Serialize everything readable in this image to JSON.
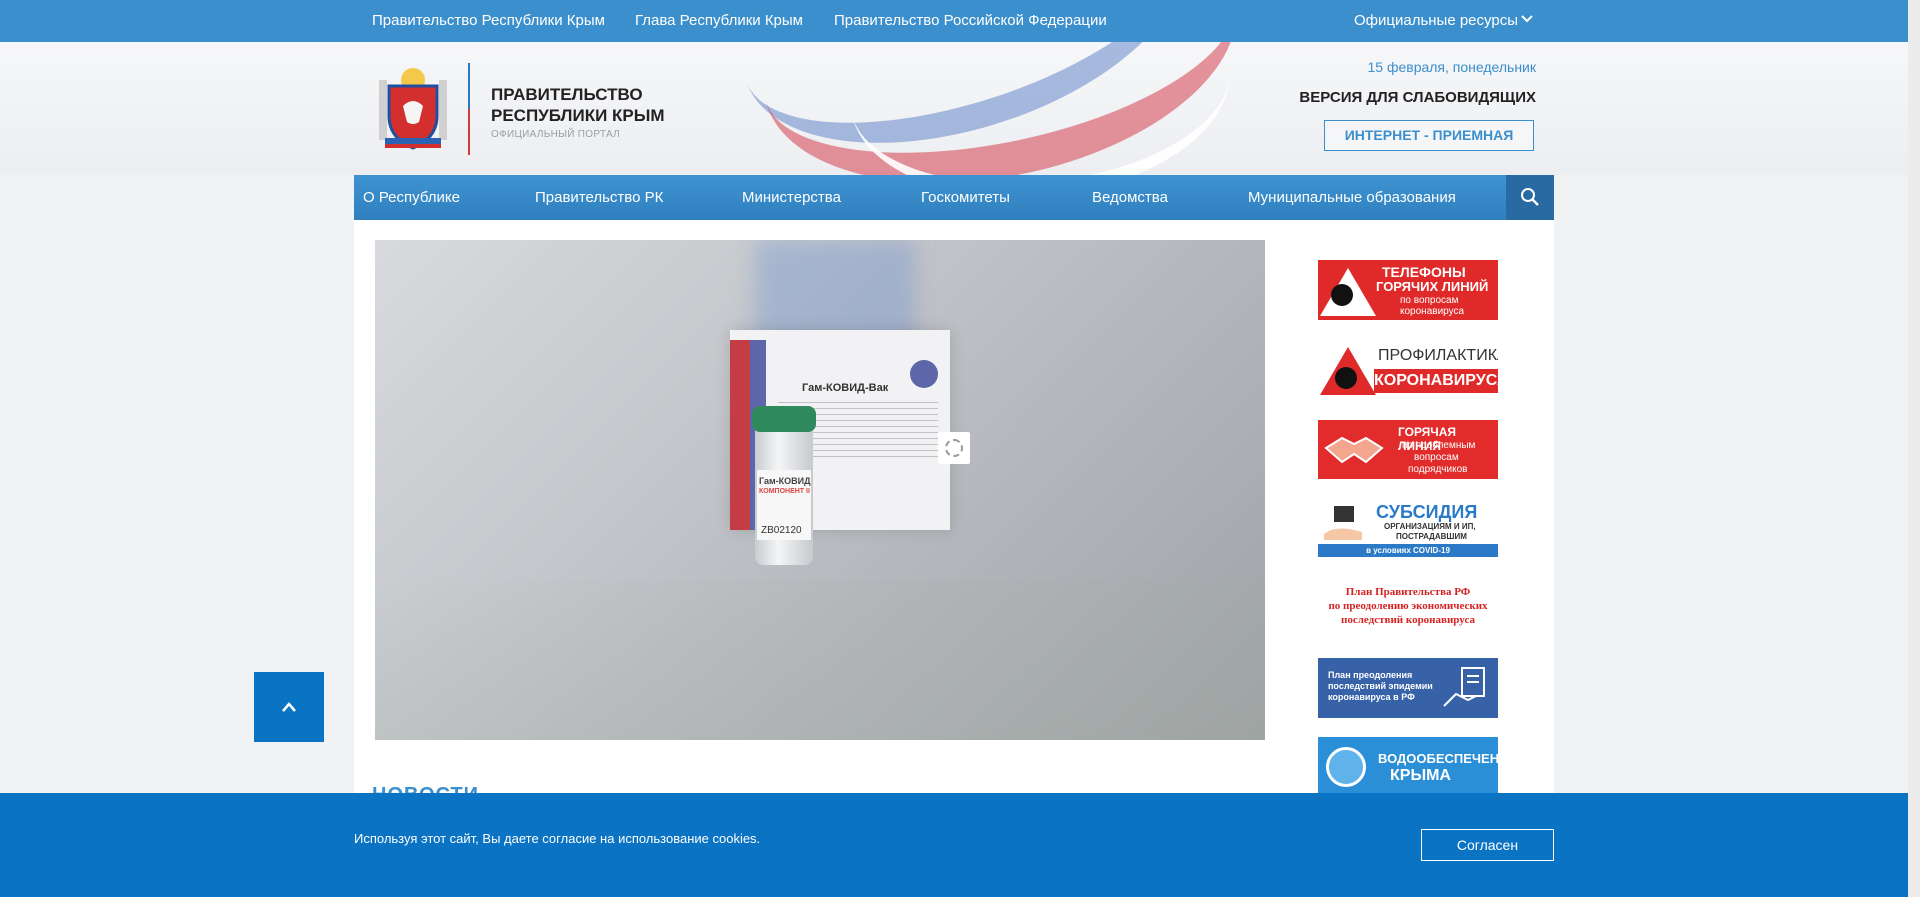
{
  "topbar": {
    "links": [
      "Правительство Республики Крым",
      "Глава Республики Крым",
      "Правительство Российской Федерации"
    ],
    "resources_label": "Официальные ресурсы"
  },
  "header": {
    "title_line1": "ПРАВИТЕЛЬСТВО",
    "title_line2": "РЕСПУБЛИКИ КРЫМ",
    "subtitle": "ОФИЦИАЛЬНЫЙ ПОРТАЛ",
    "date": "15 февраля, понедельник",
    "vision_label": "ВЕРСИЯ ДЛЯ СЛАБОВИДЯЩИХ",
    "reception_label": "ИНТЕРНЕТ - ПРИЕМНАЯ"
  },
  "nav": {
    "items": [
      "О Республике",
      "Правительство РК",
      "Министерства",
      "Госкомитеты",
      "Ведомства",
      "Муниципальные образования"
    ]
  },
  "slider": {
    "box_text": "Гам-КОВИД-Вак",
    "vial_text1": "Гам-КОВИД",
    "vial_text2": "КОМПОНЕНТ II",
    "vial_code": "ZB02120"
  },
  "news": {
    "heading": "НОВОСТИ"
  },
  "banners": {
    "b1": [
      "ТЕЛЕФОНЫ",
      "ГОРЯЧИХ ЛИНИЙ",
      "по вопросам",
      "коронавируса"
    ],
    "b2": [
      "ПРОФИЛАКТИКА",
      "КОРОНАВИРУСА"
    ],
    "b3": [
      "ГОРЯЧАЯ ЛИНИЯ",
      "по проблемным",
      "вопросам",
      "подрядчиков"
    ],
    "b4": [
      "СУБСИДИЯ",
      "ОРГАНИЗАЦИЯМ И ИП,",
      "ПОСТРАДАВШИМ",
      "в условиях COVID-19"
    ],
    "b5": [
      "План Правительства РФ",
      "по преодолению экономических",
      "последствий коронавируса"
    ],
    "b6": [
      "План преодоления",
      "последствий эпидемии",
      "коронавируса в РФ"
    ],
    "b7": [
      "ВОДООБЕСПЕЧЕНИЕ",
      "КРЫМА"
    ]
  },
  "cookie": {
    "message": "Используя этот сайт, Вы даете согласие на использование cookies.",
    "agree_label": "Согласен"
  },
  "colors": {
    "accent": "#3b8fcd",
    "nav": "#2f7fbe",
    "cookie": "#0a73c4",
    "alert_red": "#e02a2a"
  }
}
